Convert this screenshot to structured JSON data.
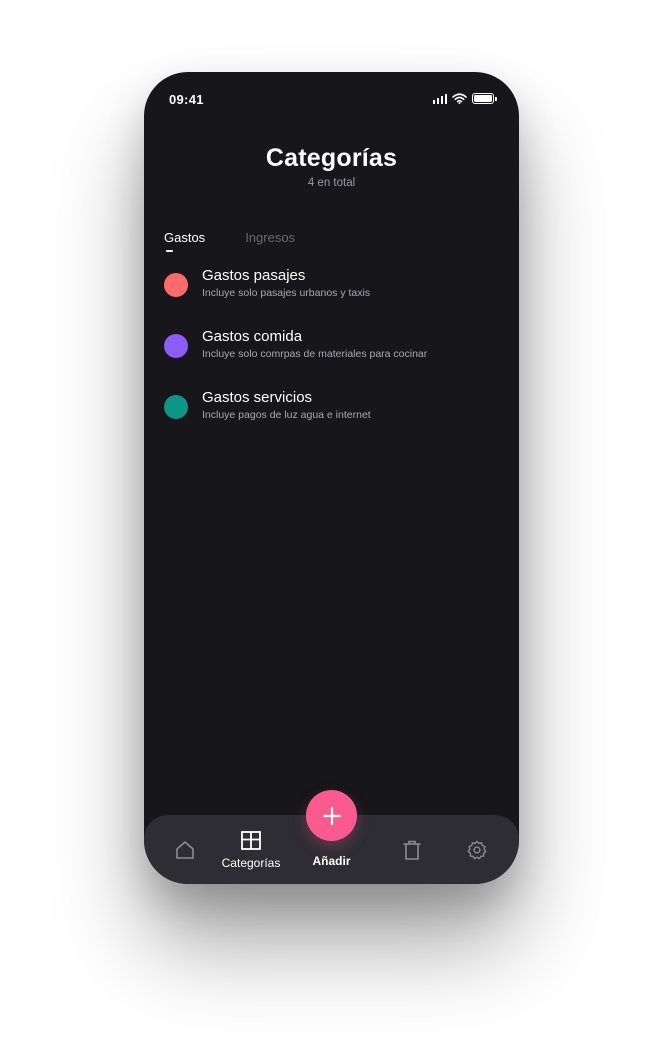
{
  "status_bar": {
    "time": "09:41"
  },
  "header": {
    "title": "Categorías",
    "subtitle": "4 en total"
  },
  "tabs": [
    {
      "label": "Gastos",
      "active": true
    },
    {
      "label": "Ingresos",
      "active": false
    }
  ],
  "categories": [
    {
      "title": "Gastos pasajes",
      "description": "Incluye solo pasajes urbanos y taxis",
      "color": "#ff6b6b"
    },
    {
      "title": "Gastos comida",
      "description": "Incluye solo comrpas de materiales para cocinar",
      "color": "#8b5cf6"
    },
    {
      "title": "Gastos servicios",
      "description": "Incluye pagos de luz agua e internet",
      "color": "#0f9488"
    }
  ],
  "nav": {
    "home_icon": "home-icon",
    "categories_label": "Categorías",
    "categories_icon": "grid-icon",
    "add_label": "Añadir",
    "add_icon": "plus-icon",
    "trash_icon": "trash-icon",
    "settings_icon": "gear-icon",
    "accent": "#fa5a8e"
  }
}
